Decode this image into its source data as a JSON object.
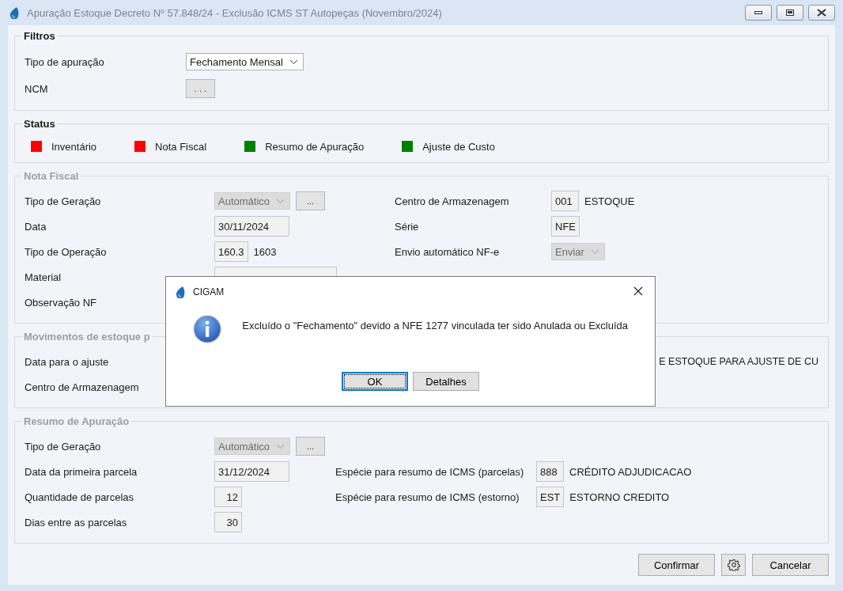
{
  "window": {
    "title": "Apuração Estoque Decreto Nº 57.848/24 - Exclusão ICMS ST Autopeças (Novembro/2024)"
  },
  "filters": {
    "title": "Filtros",
    "disabled": false,
    "rows": [
      {
        "label": "Tipo de apuração",
        "controls": [
          {
            "kind": "combo",
            "value": "Fechamento Mensal",
            "disabled": false
          }
        ]
      },
      {
        "label": "NCM",
        "controls": [
          {
            "kind": "button",
            "label": ". . ."
          }
        ]
      }
    ]
  },
  "status": {
    "title": "Status",
    "disabled": false,
    "items": [
      {
        "label": "Inventário",
        "color": "#ff0000"
      },
      {
        "label": "Nota Fiscal",
        "color": "#ff0000"
      },
      {
        "label": "Resumo de Apuração",
        "color": "#008000"
      },
      {
        "label": "Ajuste de Custo",
        "color": "#008000"
      }
    ]
  },
  "nota_fiscal": {
    "title": "Nota Fiscal",
    "disabled": true,
    "rows": [
      {
        "label": "Tipo de Geração",
        "controls": [
          {
            "kind": "combo",
            "value": "Automático",
            "disabled": true
          },
          {
            "kind": "button",
            "label": "..."
          }
        ],
        "right": {
          "label": "Centro de Armazenagem",
          "controls": [
            {
              "kind": "field",
              "value": "001"
            },
            {
              "kind": "text",
              "value": "ESTOQUE"
            }
          ]
        }
      },
      {
        "label": "Data",
        "controls": [
          {
            "kind": "date",
            "value": "30/11/2024"
          }
        ],
        "right": {
          "label": "Série",
          "controls": [
            {
              "kind": "field",
              "value": "NFE"
            }
          ]
        }
      },
      {
        "label": "Tipo de Operação",
        "controls": [
          {
            "kind": "field",
            "value": "160.3"
          },
          {
            "kind": "text",
            "value": "1603"
          }
        ],
        "right": {
          "label": "Envio automático NF-e",
          "controls": [
            {
              "kind": "combo",
              "value": "Enviar",
              "disabled": true
            }
          ]
        }
      },
      {
        "label": "Material",
        "controls": [
          {
            "kind": "wide"
          }
        ]
      },
      {
        "label": "Observação NF",
        "controls": []
      }
    ]
  },
  "movimentos": {
    "title": "Movimentos de estoque p",
    "disabled": true,
    "rows": [
      {
        "label": "Data para o ajuste",
        "controls": [],
        "tail": "E ESTOQUE PARA AJUSTE DE CU"
      },
      {
        "label": "Centro de Armazenagem",
        "controls": []
      }
    ]
  },
  "resumo": {
    "title": "Resumo de Apuração",
    "disabled": true,
    "rows": [
      {
        "label": "Tipo de Geração",
        "controls": [
          {
            "kind": "combo",
            "value": "Automático",
            "disabled": true
          },
          {
            "kind": "button",
            "label": "..."
          }
        ]
      },
      {
        "label": "Data da primeira parcela",
        "controls": [
          {
            "kind": "date",
            "value": "31/12/2024"
          }
        ],
        "right": {
          "label": "Espécie para resumo de ICMS (parcelas)",
          "controls": [
            {
              "kind": "field",
              "value": "888"
            },
            {
              "kind": "text",
              "value": "CRÉDITO ADJUDICACAO"
            }
          ]
        }
      },
      {
        "label": "Quantidade de parcelas",
        "controls": [
          {
            "kind": "number",
            "value": "12"
          }
        ],
        "right": {
          "label": "Espécie para resumo de ICMS (estorno)",
          "controls": [
            {
              "kind": "field",
              "value": "EST"
            },
            {
              "kind": "text",
              "value": "ESTORNO CREDITO"
            }
          ]
        }
      },
      {
        "label": "Dias entre as parcelas",
        "controls": [
          {
            "kind": "number",
            "value": "30"
          }
        ]
      }
    ]
  },
  "buttons": [
    {
      "kind": "text",
      "label": "Confirmar"
    },
    {
      "kind": "settings"
    },
    {
      "kind": "text",
      "label": "Cancelar"
    }
  ],
  "dialog": {
    "title": "CIGAM",
    "message": "Excluído o \"Fechamento\" devido a NFE 1277 vinculada ter sido Anulada ou Excluída",
    "buttons": [
      {
        "label": "OK",
        "selected": true
      },
      {
        "label": "Detalhes",
        "selected": false
      }
    ]
  }
}
